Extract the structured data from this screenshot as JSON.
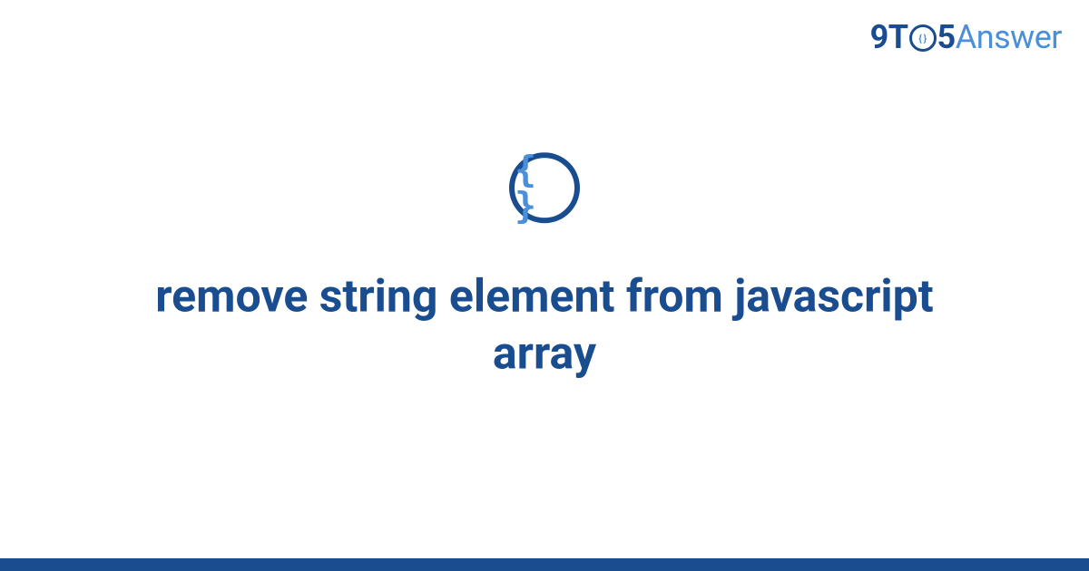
{
  "logo": {
    "part1": "9T",
    "inner_braces": "{ }",
    "part2": "5",
    "part3": "Answer"
  },
  "topic_icon": {
    "glyph": "{ }",
    "name": "code-braces-icon"
  },
  "title": "remove string element from javascript array",
  "colors": {
    "primary": "#1a4d8f",
    "accent": "#4a8fd8",
    "background": "#ffffff"
  }
}
